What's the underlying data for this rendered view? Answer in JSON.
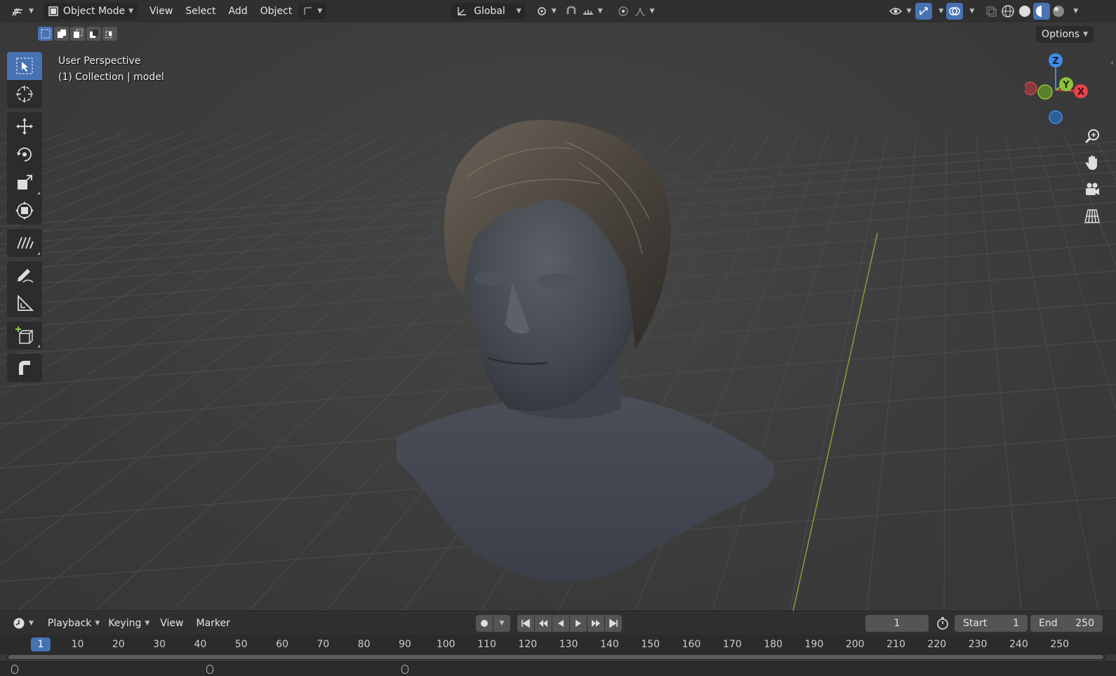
{
  "header": {
    "editor_type_icon": "editor-type-icon",
    "mode_label": "Object Mode",
    "menus": [
      "View",
      "Select",
      "Add",
      "Object"
    ],
    "transform_orientation": "Global",
    "options_label": "Options"
  },
  "viewport": {
    "perspective_label": "User Perspective",
    "collection_label": "(1) Collection | model",
    "gizmo_axes": {
      "x": "X",
      "y": "Y",
      "z": "Z"
    },
    "axis_colors": {
      "x": "#e8424b",
      "y": "#8bc43a",
      "z": "#3f8ee8"
    }
  },
  "toolbar": {
    "tools": [
      {
        "name": "select-box-tool",
        "icon": "cursor-box-icon"
      },
      {
        "name": "cursor-tool",
        "icon": "crosshair-icon"
      },
      {
        "name": "move-tool",
        "icon": "move-arrows-icon"
      },
      {
        "name": "rotate-tool",
        "icon": "rotate-icon"
      },
      {
        "name": "scale-tool",
        "icon": "scale-icon"
      },
      {
        "name": "transform-tool",
        "icon": "transform-icon"
      },
      {
        "name": "annotate-line-tool",
        "icon": "hatch-lines-icon"
      },
      {
        "name": "annotate-tool",
        "icon": "pencil-icon"
      },
      {
        "name": "measure-tool",
        "icon": "ruler-icon"
      },
      {
        "name": "add-cube-tool",
        "icon": "add-cube-icon"
      },
      {
        "name": "shear-tool",
        "icon": "shear-icon"
      }
    ]
  },
  "timeline": {
    "menus": {
      "playback": "Playback",
      "keying": "Keying",
      "view": "View",
      "marker": "Marker"
    },
    "current_frame": "1",
    "start_label": "Start",
    "start_value": "1",
    "end_label": "End",
    "end_value": "250",
    "ruler_current": "1",
    "ruler_ticks": [
      "10",
      "20",
      "30",
      "40",
      "50",
      "60",
      "70",
      "80",
      "90",
      "100",
      "110",
      "120",
      "130",
      "140",
      "150",
      "160",
      "170",
      "180",
      "190",
      "200",
      "210",
      "220",
      "230",
      "240",
      "250"
    ]
  },
  "colors": {
    "accent": "#4772b3",
    "header_bg": "#303030",
    "viewport_bg": "#3d3d3d"
  }
}
